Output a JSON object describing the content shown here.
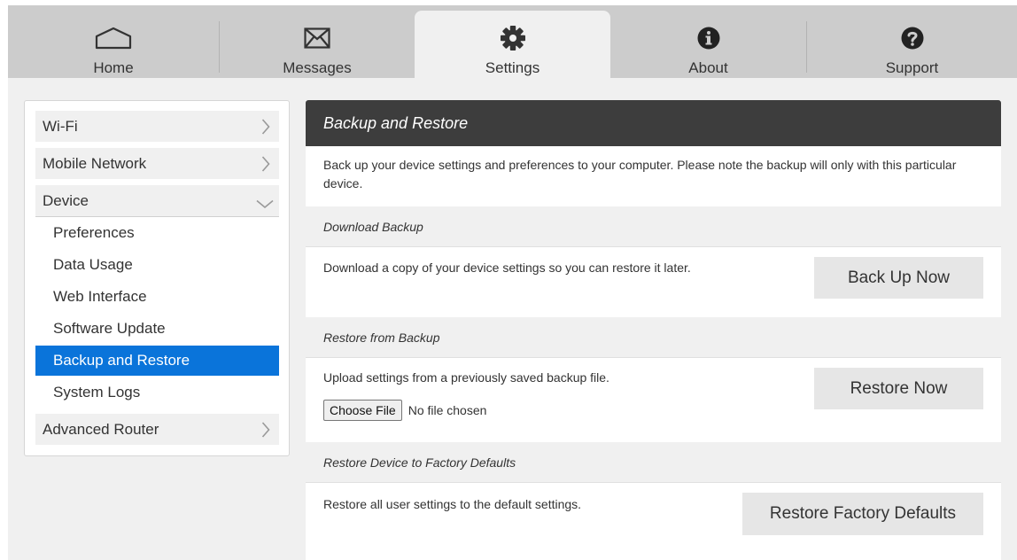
{
  "nav": {
    "tabs": [
      {
        "label": "Home",
        "icon": "home-icon"
      },
      {
        "label": "Messages",
        "icon": "envelope-icon"
      },
      {
        "label": "Settings",
        "icon": "gear-icon",
        "active": true
      },
      {
        "label": "About",
        "icon": "info-icon"
      },
      {
        "label": "Support",
        "icon": "question-icon"
      }
    ]
  },
  "sidebar": {
    "sections": [
      {
        "label": "Wi-Fi",
        "icon": "chevron-right-icon"
      },
      {
        "label": "Mobile Network",
        "icon": "chevron-right-icon"
      },
      {
        "label": "Device",
        "icon": "chevron-down-icon",
        "expanded": true
      },
      {
        "label": "Advanced Router",
        "icon": "chevron-right-icon"
      }
    ],
    "device_items": [
      {
        "label": "Preferences"
      },
      {
        "label": "Data Usage"
      },
      {
        "label": "Web Interface"
      },
      {
        "label": "Software Update"
      },
      {
        "label": "Backup and Restore",
        "selected": true
      },
      {
        "label": "System Logs"
      }
    ]
  },
  "panel": {
    "title": "Backup and Restore",
    "intro": "Back up your device settings and preferences to your computer. Please note the backup will only with this particular device.",
    "download": {
      "heading": "Download Backup",
      "description": "Download a copy of your device settings so you can restore it later.",
      "button": "Back Up Now"
    },
    "restore": {
      "heading": "Restore from Backup",
      "description": "Upload settings from a previously saved backup file.",
      "choose_file": "Choose File",
      "file_status": "No file chosen",
      "button": "Restore Now"
    },
    "factory": {
      "heading": "Restore Device to Factory Defaults",
      "description": "Restore all user settings to the default settings.",
      "button": "Restore Factory Defaults"
    }
  },
  "colors": {
    "accent": "#0a74da",
    "header_bg": "#3d3d3d",
    "nav_bg": "#cccccc",
    "active_tab_bg": "#f0f0f0"
  }
}
